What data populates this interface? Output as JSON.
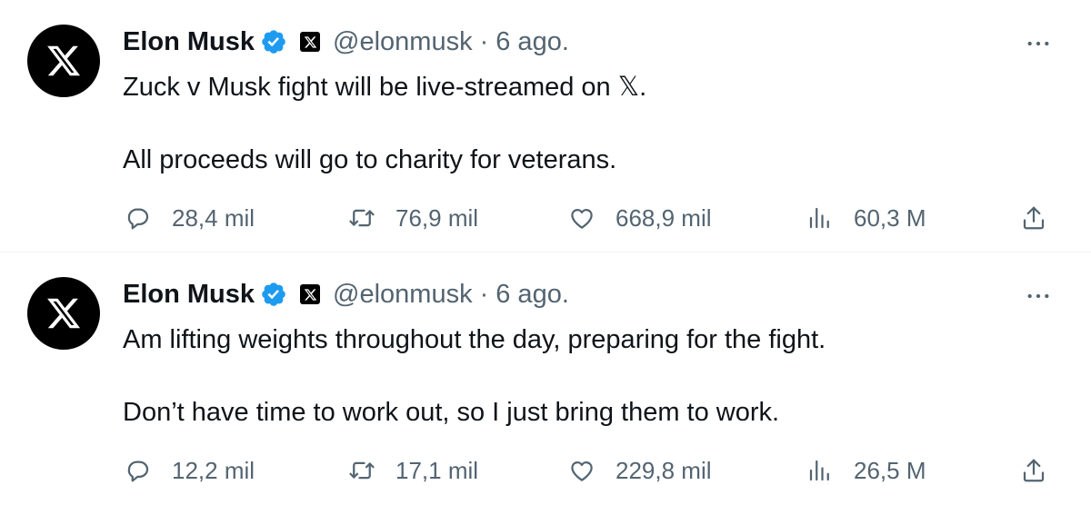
{
  "tweets": [
    {
      "author": "Elon Musk",
      "handle": "@elonmusk",
      "separator": "·",
      "time": "6 ago.",
      "lines": [
        "Zuck v Musk fight will be live-streamed on 𝕏.",
        "All proceeds will go to charity for veterans."
      ],
      "replies": "28,4 mil",
      "retweets": "76,9 mil",
      "likes": "668,9 mil",
      "views": "60,3 M"
    },
    {
      "author": "Elon Musk",
      "handle": "@elonmusk",
      "separator": "·",
      "time": "6 ago.",
      "lines": [
        "Am lifting weights throughout the day, preparing for the fight.",
        "Don’t have time to work out, so I just bring them to work."
      ],
      "replies": "12,2 mil",
      "retweets": "17,1 mil",
      "likes": "229,8 mil",
      "views": "26,5 M"
    }
  ],
  "colors": {
    "text": "#0f1419",
    "secondary": "#536471",
    "verified": "#1d9bf0",
    "divider": "#eff3f4"
  },
  "icons": [
    "x-logo-icon",
    "verified-badge-icon",
    "affiliate-x-icon",
    "more-icon",
    "reply-icon",
    "retweet-icon",
    "like-icon",
    "views-icon",
    "share-icon"
  ]
}
